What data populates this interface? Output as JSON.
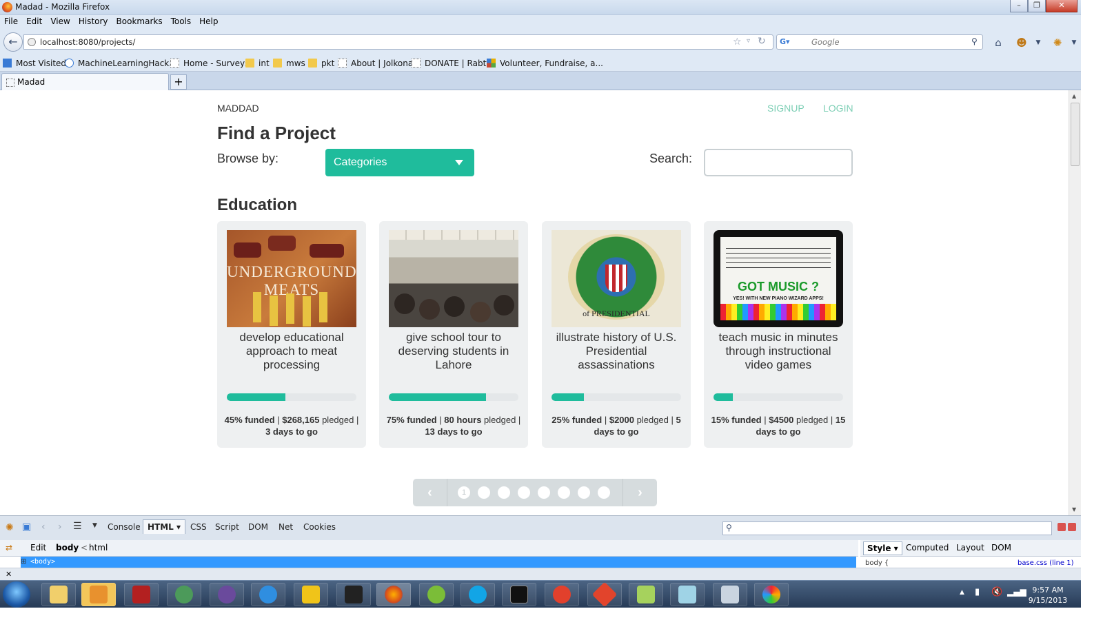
{
  "window": {
    "title": "Madad - Mozilla Firefox",
    "buttons": [
      "–",
      "❐",
      "✕"
    ]
  },
  "menu": [
    "File",
    "Edit",
    "View",
    "History",
    "Bookmarks",
    "Tools",
    "Help"
  ],
  "nav": {
    "url": "localhost:8080/projects/",
    "search_placeholder": "Google"
  },
  "bookmarks": [
    {
      "label": "Most Visited",
      "icon": "bookmark-folder-icon"
    },
    {
      "label": "MachineLearningHack...",
      "icon": "w-icon"
    },
    {
      "label": "Home - Surveys",
      "icon": "page-icon"
    },
    {
      "label": "int",
      "icon": "folder-icon"
    },
    {
      "label": "mws",
      "icon": "folder-icon"
    },
    {
      "label": "pkt",
      "icon": "folder-icon"
    },
    {
      "label": "About | Jolkona",
      "icon": "page-icon"
    },
    {
      "label": "DONATE | Rabtt",
      "icon": "page-icon"
    },
    {
      "label": "Volunteer, Fundraise, a...",
      "icon": "puzzle-icon"
    }
  ],
  "tabs": [
    {
      "label": "Madad"
    }
  ],
  "page": {
    "brand": "MADDAD",
    "links": {
      "signup": "SIGNUP",
      "login": "LOGIN"
    },
    "heading": "Find a Project",
    "browse_label": "Browse by:",
    "category_select": "Categories",
    "search_label": "Search:",
    "section": "Education",
    "projects": [
      {
        "title": "develop educational approach to meat processing",
        "pct": 45,
        "s1": "45% funded",
        "s2": " | ",
        "s3": "$268,165",
        "s4": " pledged | ",
        "s5": "3 days to go",
        "image": "meats-image",
        "overlay": "UNDERGROUND MEATS"
      },
      {
        "title": "give school tour to deserving students in Lahore",
        "pct": 75,
        "s1": "75% funded",
        "s2": " | ",
        "s3": "80 hours",
        "s4": " pledged | ",
        "s5": "13 days to go",
        "image": "school-band-image"
      },
      {
        "title": "illustrate history of U.S. Presidential assassinations",
        "pct": 25,
        "s1": "25% funded",
        "s2": " | ",
        "s3": "$2000",
        "s4": " pledged | ",
        "s5": "5 days to go",
        "image": "presidential-seal-image",
        "overlay": "of PRESIDENTIAL"
      },
      {
        "title": "teach music in minutes through instructional video games",
        "pct": 15,
        "s1": "15% funded",
        "s2": " | ",
        "s3": "$4500",
        "s4": " pledged | ",
        "s5": "15 days to go",
        "image": "got-music-tablet-image",
        "overlay": "GOT MUSIC ?",
        "overlay2": "YES! WITH NEW PIANO WIZARD APPS!"
      }
    ],
    "pager": {
      "current": "1",
      "pages": 8,
      "prev": "‹",
      "next": "›"
    }
  },
  "firebug": {
    "tabs": [
      "Console",
      "HTML",
      "CSS",
      "Script",
      "DOM",
      "Net",
      "Cookies"
    ],
    "selected_tab": "HTML",
    "edit": "Edit",
    "breadcrumb_body": "body",
    "breadcrumb_sep": "<",
    "breadcrumb_html": "html",
    "selected_node": "<body>",
    "side_tabs": [
      "Style",
      "Computed",
      "Layout",
      "DOM"
    ],
    "side_selected": "Style",
    "style_rule": "body {",
    "style_source": "base.css (line 1)"
  },
  "taskbar": {
    "time": "9:57 AM",
    "date": "9/15/2013"
  },
  "colors": {
    "accent": "#1fbc9c",
    "link": "#7dcfb5",
    "card": "#eef0f1"
  }
}
